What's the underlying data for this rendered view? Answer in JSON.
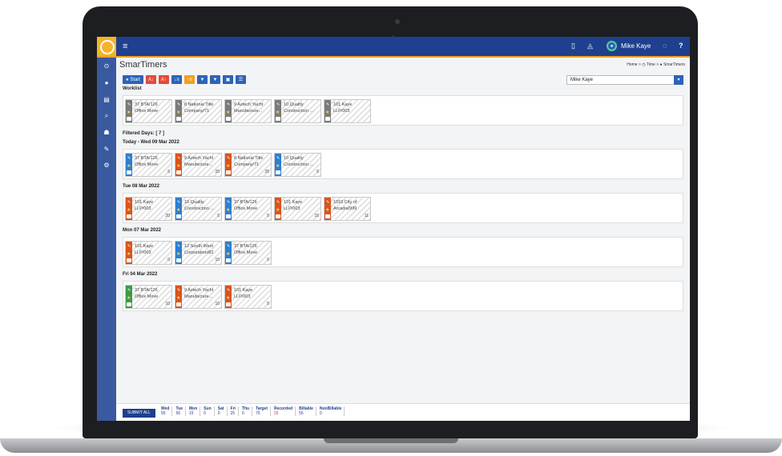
{
  "app": {
    "page_title": "SmarTimers",
    "breadcrumb": "Home > ◷ Time > ● SmarTimers",
    "user_name": "Mike Kaye",
    "user_select_value": "Mike Kaye",
    "user_select_arrow": "▾"
  },
  "topbar": {
    "menu_icon": "≡",
    "mobile_icon": "▯",
    "bell_icon": "◬",
    "chat_icon": "◌",
    "help_icon": "?",
    "avatar_glyph": "●"
  },
  "sidebar": {
    "icons": [
      "⊙",
      "●",
      "▤",
      "⌕",
      "☗",
      "✎",
      "⚙"
    ]
  },
  "toolbar": {
    "start_label": "● Start",
    "buttons": [
      {
        "glyph": "A↓",
        "color": "#e24b3b"
      },
      {
        "glyph": "A↑",
        "color": "#e24b3b"
      },
      {
        "glyph": "↓≡",
        "color": "#2d63b8"
      },
      {
        "glyph": "↑≡",
        "color": "#f0a020"
      },
      {
        "glyph": "▼",
        "color": "#2d63b8"
      },
      {
        "glyph": "▼",
        "color": "#2d63b8"
      },
      {
        "glyph": "▣",
        "color": "#2d63b8"
      },
      {
        "glyph": "☰",
        "color": "#2d63b8"
      }
    ]
  },
  "worklist": {
    "label": "Worklist",
    "cards": [
      {
        "line1": "37 BTA/126",
        "line2": "Office Move",
        "hours": "",
        "color": "#7a7a7a"
      },
      {
        "line1": "8 National Title",
        "line2": "Company/71",
        "hours": "",
        "color": "#7a7a7a"
      },
      {
        "line1": "9 Aztech Yacht",
        "line2": "Manufacture...",
        "hours": "",
        "color": "#7a7a7a"
      },
      {
        "line1": "10 Quality",
        "line2": "Construction ...",
        "hours": "",
        "color": "#7a7a7a"
      },
      {
        "line1": "101 Kaye",
        "line2": "LLP/003",
        "hours": "",
        "color": "#7a7a7a"
      }
    ]
  },
  "filtered_days_label": "Filtered Days: [ 7 ]",
  "days": [
    {
      "label": "Today - Wed 09 Mar 2022",
      "cards": [
        {
          "line1": "37 BTA/126",
          "line2": "Office Move",
          "hours": "5",
          "color": "#2d7fd0"
        },
        {
          "line1": "9 Aztech Yacht",
          "line2": "Manufacture...",
          "hours": "20",
          "color": "#d9541e"
        },
        {
          "line1": "8 National Title",
          "line2": "Company/71",
          "hours": "25",
          "color": "#d9541e"
        },
        {
          "line1": "10 Quality",
          "line2": "Construction ...",
          "hours": "5",
          "color": "#2d7fd0"
        }
      ]
    },
    {
      "label": "Tue 08 Mar 2022",
      "cards": [
        {
          "line1": "101 Kaye",
          "line2": "LLP/003",
          "hours": "20",
          "color": "#d9541e"
        },
        {
          "line1": "10 Quality",
          "line2": "Construction ...",
          "hours": "5",
          "color": "#2d7fd0"
        },
        {
          "line1": "37 BTA/126",
          "line2": "Office Move",
          "hours": "5",
          "color": "#2d7fd0"
        },
        {
          "line1": "101 Kaye",
          "line2": "LLP/003",
          "hours": "15",
          "color": "#d9541e"
        },
        {
          "line1": "1010 City of",
          "line2": "Arcadia/999",
          "hours": "11",
          "color": "#d9541e"
        }
      ]
    },
    {
      "label": "Mon 07 Mar 2022",
      "cards": [
        {
          "line1": "101 Kaye",
          "line2": "LLP/003",
          "hours": "0",
          "color": "#d9541e"
        },
        {
          "line1": "12 South West",
          "line2": "Corporation/82",
          "hours": "10",
          "color": "#2d7fd0"
        },
        {
          "line1": "37 BTA/126",
          "line2": "Office Move",
          "hours": "5",
          "color": "#2d7fd0"
        }
      ]
    },
    {
      "label": "Fri 04 Mar 2022",
      "cards": [
        {
          "line1": "37 BTA/126",
          "line2": "Office Move",
          "hours": "10",
          "color": "#3a9a4a"
        },
        {
          "line1": "9 Aztech Yacht",
          "line2": "Manufacture...",
          "hours": "10",
          "color": "#d9541e"
        },
        {
          "line1": "101 Kaye",
          "line2": "LLP/003",
          "hours": "5",
          "color": "#d9541e"
        }
      ]
    }
  ],
  "footer": {
    "submit_label": "SUBMIT ALL",
    "stats": [
      {
        "label": "Wed",
        "value": "55",
        "red": false
      },
      {
        "label": "Tue",
        "value": "56",
        "red": false
      },
      {
        "label": "Mon",
        "value": "15",
        "red": false
      },
      {
        "label": "Sun",
        "value": "0",
        "red": false
      },
      {
        "label": "Sat",
        "value": "0",
        "red": false
      },
      {
        "label": "Fri",
        "value": "25",
        "red": false
      },
      {
        "label": "Thu",
        "value": "0",
        "red": false
      },
      {
        "label": "Target",
        "value": "75",
        "red": false
      },
      {
        "label": "Recorded",
        "value": "55",
        "red": true
      },
      {
        "label": "Billable",
        "value": "55",
        "red": false
      },
      {
        "label": "NonBillable",
        "value": "0",
        "red": false
      }
    ]
  }
}
